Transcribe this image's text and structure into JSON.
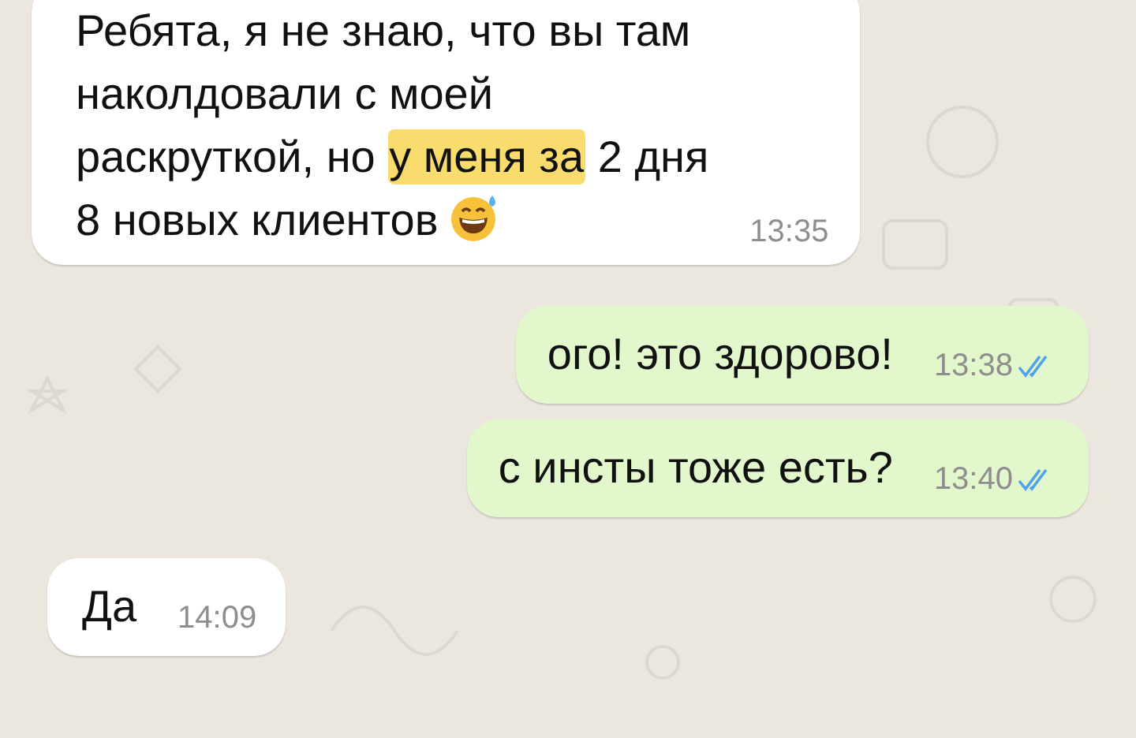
{
  "messages": [
    {
      "kind": "incoming",
      "segments": [
        {
          "kind": "text",
          "text": "Ребята, я не знаю, что вы там\nнаколдовали с моей\nраскруткой, но ",
          "highlight": false
        },
        {
          "kind": "text",
          "text": "у меня за",
          "highlight": true
        },
        {
          "kind": "text",
          "text": " 2 дня\n8 новых клиентов ",
          "highlight": false
        },
        {
          "kind": "emoji"
        }
      ],
      "time": "13:35"
    },
    {
      "kind": "outgoing",
      "segments": [
        {
          "kind": "text",
          "text": "ого! это здорово!",
          "highlight": false
        }
      ],
      "time": "13:38",
      "read": true
    },
    {
      "kind": "outgoing",
      "segments": [
        {
          "kind": "text",
          "text": "с инсты тоже есть?",
          "highlight": false
        }
      ],
      "time": "13:40",
      "read": true
    },
    {
      "kind": "incoming",
      "segments": [
        {
          "kind": "text",
          "text": "Да",
          "highlight": false
        }
      ],
      "time": "14:09"
    }
  ]
}
